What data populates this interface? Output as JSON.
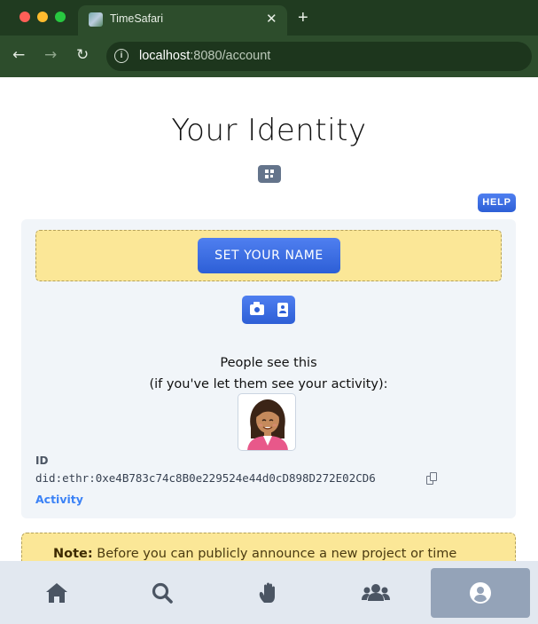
{
  "browser": {
    "tab_title": "TimeSafari",
    "tab_close": "✕",
    "new_tab": "+",
    "url_host": "localhost",
    "url_rest": ":8080/account"
  },
  "page": {
    "title": "Your Identity",
    "help_label": "HELP",
    "set_name_label": "SET YOUR NAME",
    "people_see_line1": "People see this",
    "people_see_line2": "(if you've let them see your activity):",
    "id_label": "ID",
    "did": "did:ethr:0xe4B783c74c8B0e229524e44d0cD898D272E02CD6",
    "activity_link": "Activity",
    "note_label": "Note:",
    "note_text": " Before you can publicly announce a new project or time"
  },
  "bottom_nav": {
    "items": [
      {
        "icon": "home-icon"
      },
      {
        "icon": "search-icon"
      },
      {
        "icon": "hand-icon"
      },
      {
        "icon": "contacts-icon"
      },
      {
        "icon": "profile-icon",
        "active": true
      }
    ]
  },
  "colors": {
    "accent_blue": "#2d5fd6",
    "note_yellow": "#fbe797",
    "chrome_green": "#2d4d2c"
  }
}
